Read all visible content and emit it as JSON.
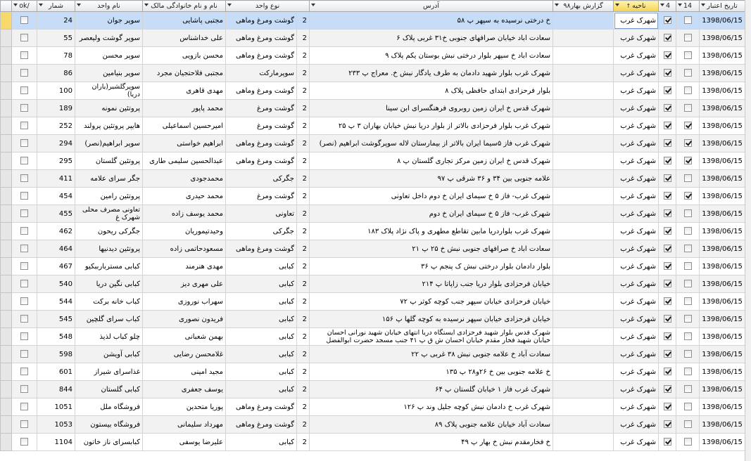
{
  "columns": {
    "ok": "ok/",
    "number": "شمار",
    "shop_name": "نام واحد",
    "owner": "نام و نام خانوادگی مالک",
    "unit_type": "نوع واحد",
    "address": "آدرس",
    "report": "گزارش بهار۹۸",
    "area": "ناحیه",
    "area_sort_icon": "sort-ascending-icon",
    "c4": "4",
    "c14": "14",
    "date": "تاریخ اعتبار"
  },
  "rows": [
    {
      "ok": false,
      "number": "24",
      "shop": "سوپر جوان",
      "owner": "مجتبی پاشایی",
      "type": "گوشت ومرغ وماهی",
      "nt": "2",
      "address": "خ درختی نرسیده به سپهر پ ۵۸",
      "area": "شهرک غرب",
      "c4": true,
      "c14": false,
      "date": "1398/06/15",
      "selected": true
    },
    {
      "ok": false,
      "number": "55",
      "shop": "سوپر گوشت ولیعصر",
      "owner": "علی خداشناس",
      "type": "گوشت ومرغ وماهی",
      "nt": "2",
      "address": "سعادت اباد خیابان صرافهای جنوبی خ۳۱ غربی پلاک ۶",
      "area": "شهرک غرب",
      "c4": true,
      "c14": false,
      "date": "1398/06/15"
    },
    {
      "ok": false,
      "number": "78",
      "shop": "سوپر محسن",
      "owner": "محسن بازویی",
      "type": "گوشت ومرغ وماهی",
      "nt": "2",
      "address": "سعادت اباد خ سپهر بلوار درختی نبش بوستان یکم پلاک ۹",
      "area": "شهرک غرب",
      "c4": true,
      "c14": false,
      "date": "1398/06/15"
    },
    {
      "ok": false,
      "number": "86",
      "shop": "سوپر بنیامین",
      "owner": "مجتبی فلاحتجیان مجرد",
      "type": "سوپرمارکت",
      "nt": "2",
      "address": "شهرک غرب بلوار شهید دادمان به طرف یادگار نبش خ. معراج پ ۲۳۳",
      "area": "شهرک غرب",
      "c4": true,
      "c14": false,
      "date": "1398/06/15"
    },
    {
      "ok": false,
      "number": "100",
      "shop": "سوپرگلشیر(یاران دریا)",
      "owner": "مهدی قاهری",
      "type": "گوشت ومرغ وماهی",
      "nt": "2",
      "address": "بلوار فرحزادی ابتدای حافظی پلاک ۸",
      "area": "شهرک غرب",
      "c4": true,
      "c14": false,
      "date": "1398/06/15",
      "wrap_shop": true
    },
    {
      "ok": false,
      "number": "189",
      "shop": "پروتئین نمونه",
      "owner": "محمد پاپور",
      "type": "گوشت ومرغ",
      "nt": "2",
      "address": "شهرک قدس خ ایران زمین روبروی فرهنگسرای ابن سینا",
      "area": "شهرک غرب",
      "c4": true,
      "c14": false,
      "date": "1398/06/15"
    },
    {
      "ok": false,
      "number": "252",
      "shop": "هایپر پروتئین پرولند",
      "owner": "امیرحسین اسماعیلی",
      "type": "گوشت ومرغ",
      "nt": "2",
      "address": "شهرک غرب بلوار فرحزادی بالاتر از بلوار دریا نبش خیابان بهاران ۳ پ ۲۵",
      "area": "شهرک غرب",
      "c4": true,
      "c14": true,
      "date": "1398/06/15"
    },
    {
      "ok": false,
      "number": "294",
      "shop": "سوپر ابراهیم(نصر)",
      "owner": "ابراهیم خواستی",
      "type": "گوشت ومرغ وماهی",
      "nt": "2",
      "address": "شهرک غرب فاز ۵سیما ایران بالاتر از بیمارستان لاله سوپرگوشت ابراهیم (نصر)",
      "area": "شهرک غرب",
      "c4": true,
      "c14": true,
      "date": "1398/06/15"
    },
    {
      "ok": false,
      "number": "295",
      "shop": "پروتئین گلستان",
      "owner": "عبدالحسین سلیمی طاری",
      "type": "گوشت ومرغ وماهی",
      "nt": "2",
      "address": "شهرک قدس خ ایران زمین مرکز تجاری گلستان پ ۸",
      "area": "شهرک غرب",
      "c4": true,
      "c14": true,
      "date": "1398/06/15"
    },
    {
      "ok": false,
      "number": "411",
      "shop": "جگر سرای علامه",
      "owner": "محمدجودی",
      "type": "جگرکی",
      "nt": "2",
      "address": "علامه جنوبی بین ۳۴ و ۳۶ شرقی پ ۹۷",
      "area": "شهرک غرب",
      "c4": true,
      "c14": false,
      "date": "1398/06/15"
    },
    {
      "ok": false,
      "number": "454",
      "shop": "پروتئین رامین",
      "owner": "محمد حیدری",
      "type": "گوشت ومرغ",
      "nt": "2",
      "address": "شهرک غرب- فاز ۵ خ سیمای ایران خ دوم داخل تعاونی",
      "area": "شهرک غرب",
      "c4": true,
      "c14": true,
      "date": "1398/06/15"
    },
    {
      "ok": false,
      "number": "455",
      "shop": "تعاونی مصرف محلی شهرک غ",
      "owner": "محمد یوسف زاده",
      "type": "تعاونی",
      "nt": "2",
      "address": "شهرک غرب- فاز ۵ خ سیمای ایران خ دوم",
      "area": "شهرک غرب",
      "c4": true,
      "c14": false,
      "date": "1398/06/15",
      "wrap_shop": true
    },
    {
      "ok": false,
      "number": "462",
      "shop": "جگرکی ریحون",
      "owner": "وحیدتیموریان",
      "type": "جگرکی",
      "nt": "2",
      "address": "شهرک غرب بلواردریا مابین تقاطع مطهری و پاک نژاد پلاک ۱۸۳",
      "area": "شهرک غرب",
      "c4": true,
      "c14": false,
      "date": "1398/06/15"
    },
    {
      "ok": false,
      "number": "464",
      "shop": "پروتئین دیدنیها",
      "owner": "مسعودحاتمی زاده",
      "type": "گوشت ومرغ وماهی",
      "nt": "2",
      "address": "سعادت اباد خ صرافهای جنوبی نبش خ ۲۵ پ ۲۱",
      "area": "شهرک غرب",
      "c4": true,
      "c14": false,
      "date": "1398/06/15"
    },
    {
      "ok": false,
      "number": "467",
      "shop": "کبابی مستربارببکیو",
      "owner": "مهدی هنرمند",
      "type": "کبابی",
      "nt": "2",
      "address": "بلوار دادمان بلوار درختی نبش ک پنجم پ ۳۶",
      "area": "شهرک غرب",
      "c4": true,
      "c14": false,
      "date": "1398/06/15"
    },
    {
      "ok": false,
      "number": "540",
      "shop": "کبابی نگین دریا",
      "owner": "علی مهری دیز",
      "type": "کبابی",
      "nt": "2",
      "address": "خیابان فرحزادی بلوار دریا جنب زاپاتا پ ۲۱۴",
      "area": "شهرک غرب",
      "c4": true,
      "c14": false,
      "date": "1398/06/15"
    },
    {
      "ok": false,
      "number": "544",
      "shop": "کباب خانه برکت",
      "owner": "سهراب نوروزی",
      "type": "کبابی",
      "nt": "2",
      "address": "خیابان فرحزادی خیابان سپهر جنب کوچه کوثر پ ۷۲",
      "area": "شهرک غرب",
      "c4": true,
      "c14": false,
      "date": "1398/06/15"
    },
    {
      "ok": false,
      "number": "545",
      "shop": "کباب سرای گلچین",
      "owner": "فریدون نصوری",
      "type": "کبابی",
      "nt": "2",
      "address": "خیابان فرحزادی خیابان سپهر نرسیده به کوچه گلها پ ۱۵۶",
      "area": "شهرک غرب",
      "c4": true,
      "c14": false,
      "date": "1398/06/15"
    },
    {
      "ok": false,
      "number": "548",
      "shop": "چلو کباب لذیذ",
      "owner": "بهمن شعبانی",
      "type": "کبابی",
      "nt": "2",
      "address": "شهرک قدس بلوار شهید فرحزادی ایستگاه دریا انتهای خیابان شهید نورانی احسان خیابان شهید فخار مقدم خیابان احسان ش ق پ ۴۱ جنب مسجد حضرت ابوالفضل",
      "area": "شهرک غرب",
      "c4": true,
      "c14": false,
      "date": "1398/06/15",
      "wrap_addr": true
    },
    {
      "ok": false,
      "number": "598",
      "shop": "کبابی آویشن",
      "owner": "غلامحسن رضایی",
      "type": "کبابی",
      "nt": "2",
      "address": "سعادت آباد خ علامه جنوبی نبش ۳۸ غربی پ ۲۲",
      "area": "شهرک غرب",
      "c4": true,
      "c14": false,
      "date": "1398/06/15"
    },
    {
      "ok": false,
      "number": "601",
      "shop": "غذاسرای شیراز",
      "owner": "مجید امینی",
      "type": "کبابی",
      "nt": "2",
      "address": "خ علامه جنوبی بین خ ۲۶و۲۸ پ ۱۳۵",
      "area": "شهرک غرب",
      "c4": true,
      "c14": false,
      "date": "1398/06/15"
    },
    {
      "ok": false,
      "number": "844",
      "shop": "کبابی گلستان",
      "owner": "یوسف جعفری",
      "type": "کبابی",
      "nt": "2",
      "address": "شهرک غرب فاز ۱ خیابان گلستان پ ۶۴",
      "area": "شهرک غرب",
      "c4": true,
      "c14": false,
      "date": "1398/06/15"
    },
    {
      "ok": false,
      "number": "1051",
      "shop": "فروشگاه ملل",
      "owner": "پوریا متحدین",
      "type": "گوشت ومرغ وماهی",
      "nt": "2",
      "address": "شهرک غرب خ دادمان نبش کوچه جلیل وند پ ۱۲۶",
      "area": "شهرک غرب",
      "c4": true,
      "c14": false,
      "date": "1398/06/15"
    },
    {
      "ok": false,
      "number": "1053",
      "shop": "فروشگاه بیستون",
      "owner": "مهرداد سلیمانی",
      "type": "گوشت ومرغ وماهی",
      "nt": "2",
      "address": "سعادت آباد خیابان علامه جنوبی پلاک ۸۹",
      "area": "شهرک غرب",
      "c4": true,
      "c14": false,
      "date": "1398/06/15"
    },
    {
      "ok": false,
      "number": "1104",
      "shop": "کبابسرای ناز خاتون",
      "owner": "علیرضا یوسفی",
      "type": "کبابی",
      "nt": "2",
      "address": "خ فخارمقدم نبش خ بهار پ ۴۹",
      "area": "شهرک غرب",
      "c4": true,
      "c14": false,
      "date": "1398/06/15"
    }
  ]
}
